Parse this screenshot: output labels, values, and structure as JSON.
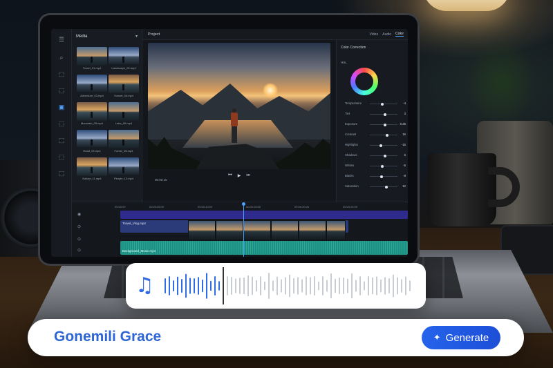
{
  "editor": {
    "media_panel": {
      "title": "Media",
      "thumbnails": [
        "Travel_01.mp4",
        "Landscape_02.mp4",
        "Adventure_03.mp4",
        "Sunset_04.mp4",
        "Mountain_05.mp4",
        "Lake_06.mp4",
        "Road_05.mp4",
        "Forest_08.mp4",
        "Nature_11.mp4",
        "People_12.mp4"
      ]
    },
    "preview": {
      "project_title": "Project",
      "timecode": "00:00:10"
    },
    "inspector": {
      "tabs": [
        "Video",
        "Audio",
        "Color"
      ],
      "active_tab": "Color",
      "section_title": "Color Correction",
      "hsl_label": "HSL",
      "adjustments": [
        {
          "label": "Temperature",
          "value": "-4",
          "level": 0.45
        },
        {
          "label": "Tint",
          "value": "3",
          "level": 0.55
        },
        {
          "label": "Exposure",
          "value": "0.25",
          "level": 0.55
        },
        {
          "label": "Contrast",
          "value": "16",
          "level": 0.62
        },
        {
          "label": "Highlights",
          "value": "-15",
          "level": 0.4
        },
        {
          "label": "Shadows",
          "value": "6",
          "level": 0.55
        },
        {
          "label": "Whites",
          "value": "-5",
          "level": 0.45
        },
        {
          "label": "Blacks",
          "value": "-8",
          "level": 0.42
        },
        {
          "label": "Saturation",
          "value": "12",
          "level": 0.6
        }
      ]
    },
    "timeline": {
      "ruler": [
        "00:00:00",
        "00:00:05:00",
        "00:00:10:00",
        "00:00:15:00",
        "00:00:20:00",
        "00:00:25:00"
      ],
      "video_track_label": "Travel_Vlog.mp4",
      "audio_track_label": "Background_Music.mp3"
    }
  },
  "audio_card": {
    "icon": "music-note-icon"
  },
  "prompt_bar": {
    "text": "Gonemili Grace",
    "button_label": "Generate",
    "button_icon": "sparkle-icon",
    "accent_color": "#2563eb"
  }
}
